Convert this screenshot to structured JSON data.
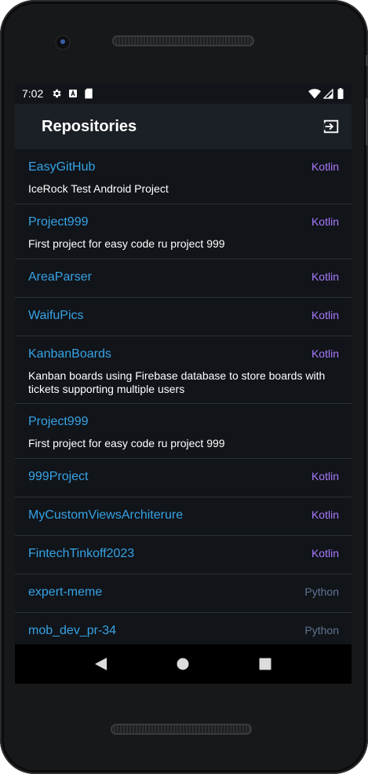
{
  "status_bar": {
    "time": "7:02",
    "left_icons": [
      "settings-icon",
      "a-notification-icon",
      "sd-card-icon"
    ],
    "right_icons": [
      "wifi-icon",
      "signal-icon",
      "battery-icon"
    ]
  },
  "app_bar": {
    "title": "Repositories",
    "action_icon": "logout-icon"
  },
  "colors": {
    "background": "#111419",
    "app_bar": "#1b1f26",
    "repo_name": "#36a3e6",
    "kotlin": "#a97bff",
    "python": "#5e7691",
    "divider": "#2c3038"
  },
  "repositories": [
    {
      "name": "EasyGitHub",
      "language": "Kotlin",
      "description": "IceRock Test Android Project"
    },
    {
      "name": "Project999",
      "language": "Kotlin",
      "description": "First project for easy code ru project 999"
    },
    {
      "name": "AreaParser",
      "language": "Kotlin",
      "description": ""
    },
    {
      "name": "WaifuPics",
      "language": "Kotlin",
      "description": ""
    },
    {
      "name": "KanbanBoards",
      "language": "Kotlin",
      "description": "Kanban boards using Firebase database to store boards with tickets supporting multiple users"
    },
    {
      "name": "Project999",
      "language": "",
      "description": "First project for easy code ru project 999"
    },
    {
      "name": "999Project",
      "language": "Kotlin",
      "description": ""
    },
    {
      "name": "MyCustomViewsArchiterure",
      "language": "Kotlin",
      "description": ""
    },
    {
      "name": "FintechTinkoff2023",
      "language": "Kotlin",
      "description": ""
    },
    {
      "name": "expert-meme",
      "language": "Python",
      "description": ""
    },
    {
      "name": "mob_dev_pr-34",
      "language": "Python",
      "description": ""
    }
  ],
  "nav_bar": {
    "buttons": [
      "back-icon",
      "home-icon",
      "recents-icon"
    ]
  }
}
